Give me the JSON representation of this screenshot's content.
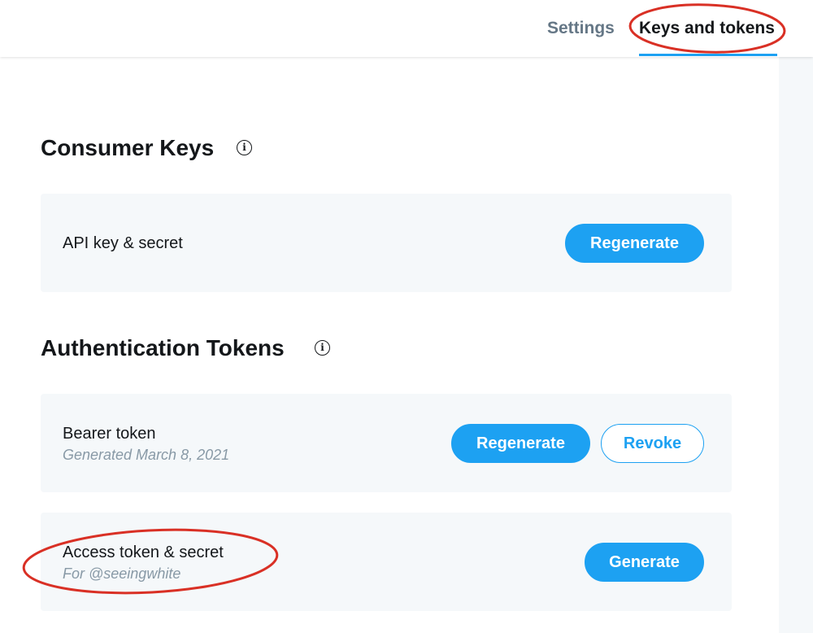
{
  "tabs": [
    {
      "label": "Settings"
    },
    {
      "label": "Keys and tokens",
      "active": true
    }
  ],
  "consumer_keys": {
    "title": "Consumer Keys",
    "info_icon": "i",
    "rows": [
      {
        "label": "API key & secret",
        "buttons": [
          "Regenerate"
        ]
      }
    ]
  },
  "auth_tokens": {
    "title": "Authentication Tokens",
    "info_icon": "i",
    "rows": [
      {
        "label": "Bearer token",
        "sub": "Generated March 8, 2021",
        "buttons": [
          "Regenerate",
          "Revoke"
        ]
      },
      {
        "label": "Access token & secret",
        "sub": "For @seeingwhite",
        "buttons": [
          "Generate"
        ]
      }
    ]
  },
  "colors": {
    "accent": "#1da1f2",
    "annotation": "#d93025"
  }
}
